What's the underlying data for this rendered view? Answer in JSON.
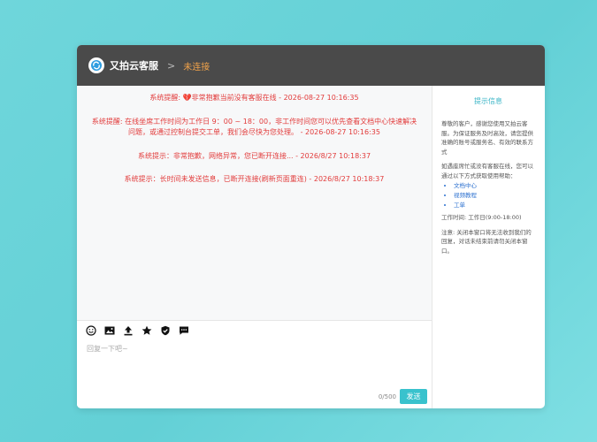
{
  "header": {
    "title": "又拍云客服",
    "separator": ">",
    "status": "未连接"
  },
  "messages": [
    {
      "text": "系统提醒: 💔非常抱歉当前没有客服在线 - 2026-08-27 10:16:35"
    },
    {
      "text": "系统提醒: 在线坐席工作时间为工作日 9：00 ~ 18：00，非工作时间您可以优先查看文档中心快速解决问题，或通过控制台提交工单，我们会尽快为您处理。 - 2026-08-27 10:16:35"
    },
    {
      "text": "系统提示：非常抱歉，网络异常，您已断开连接... - 2026/8/27 10:18:37"
    },
    {
      "text": "系统提示：长时间未发送信息，已断开连接(刷新页面重连) - 2026/8/27 10:18:37"
    }
  ],
  "toolbar": {
    "icons": [
      "emoji-icon",
      "image-icon",
      "upload-icon",
      "star-icon",
      "shield-icon",
      "comment-icon"
    ]
  },
  "reply": {
    "placeholder": "回复一下吧~",
    "value": "",
    "counter": "0/500",
    "send_label": "发送"
  },
  "info": {
    "title": "提示信息",
    "para1": "尊敬的客户，感谢您使用又拍云客服。为保证服务及时高效，请您提供准确的账号或服务名、有效的联系方式",
    "para2": "如遇座席忙或没有客服在线，您可以通过以下方式获取使用帮助：",
    "links": [
      "文档中心",
      "视频教程",
      "工单"
    ],
    "hours": "工作时间: 工作日(9:00-18:00)",
    "note": "注意: 关闭本窗口将无法收到我们的回复，对话未结束前请勿关闭本窗口。"
  },
  "colors": {
    "header_bg": "#4a4a4a",
    "status": "#f0a24a",
    "system_message": "#e23b3b",
    "accent": "#39c2cd",
    "link": "#2a6fcf"
  }
}
